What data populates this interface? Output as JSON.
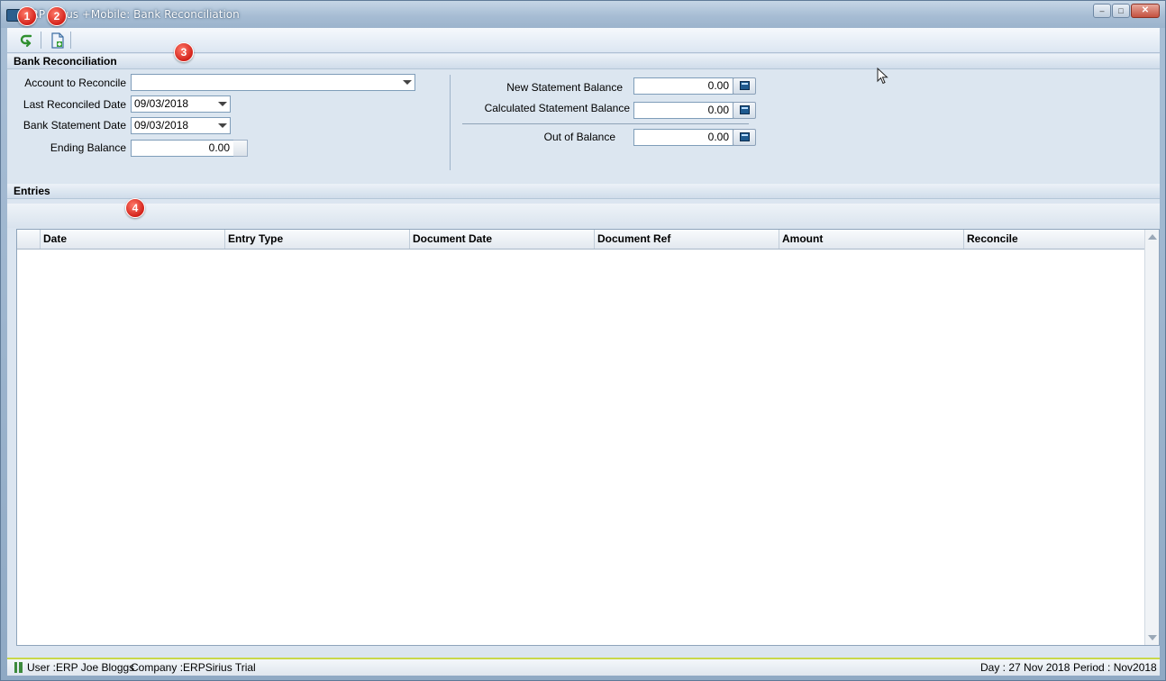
{
  "window": {
    "title": "ERP Sirius +Mobile: Bank Reconciliation",
    "minimize_glyph": "–",
    "maximize_glyph": "□",
    "close_glyph": "✕"
  },
  "toolbar": {
    "buttons": [
      {
        "icon": "return-icon"
      },
      {
        "icon": "new-document-icon"
      }
    ]
  },
  "bank_reconciliation": {
    "header": "Bank Reconciliation",
    "account_label": "Account to Reconcile",
    "account_value": "",
    "last_reconciled_label": "Last Reconciled Date",
    "last_reconciled_value": "09/03/2018",
    "bank_statement_label": "Bank Statement Date",
    "bank_statement_value": "09/03/2018",
    "ending_balance_label": "Ending Balance",
    "ending_balance_value": "0.00",
    "new_statement_label": "New Statement Balance",
    "new_statement_value": "0.00",
    "calculated_statement_label": "Calculated Statement Balance",
    "calculated_statement_value": "0.00",
    "out_of_balance_label": "Out of Balance",
    "out_of_balance_value": "0.00"
  },
  "entries": {
    "header": "Entries",
    "columns": [
      "Date",
      "Entry Type",
      "Document Date",
      "Document Ref",
      "Amount",
      "Reconcile"
    ],
    "rows": []
  },
  "status": {
    "user": "User :ERP Joe Bloggs",
    "company": "Company :ERPSirius Trial",
    "day": "Day : 27 Nov 2018",
    "period": "Period : Nov2018"
  },
  "annotations": [
    "1",
    "2",
    "3",
    "4"
  ],
  "colors": {
    "badge": "#d3221a",
    "status_accent": "#c9d84a",
    "title_gradient_top": "#c6d6e6"
  }
}
